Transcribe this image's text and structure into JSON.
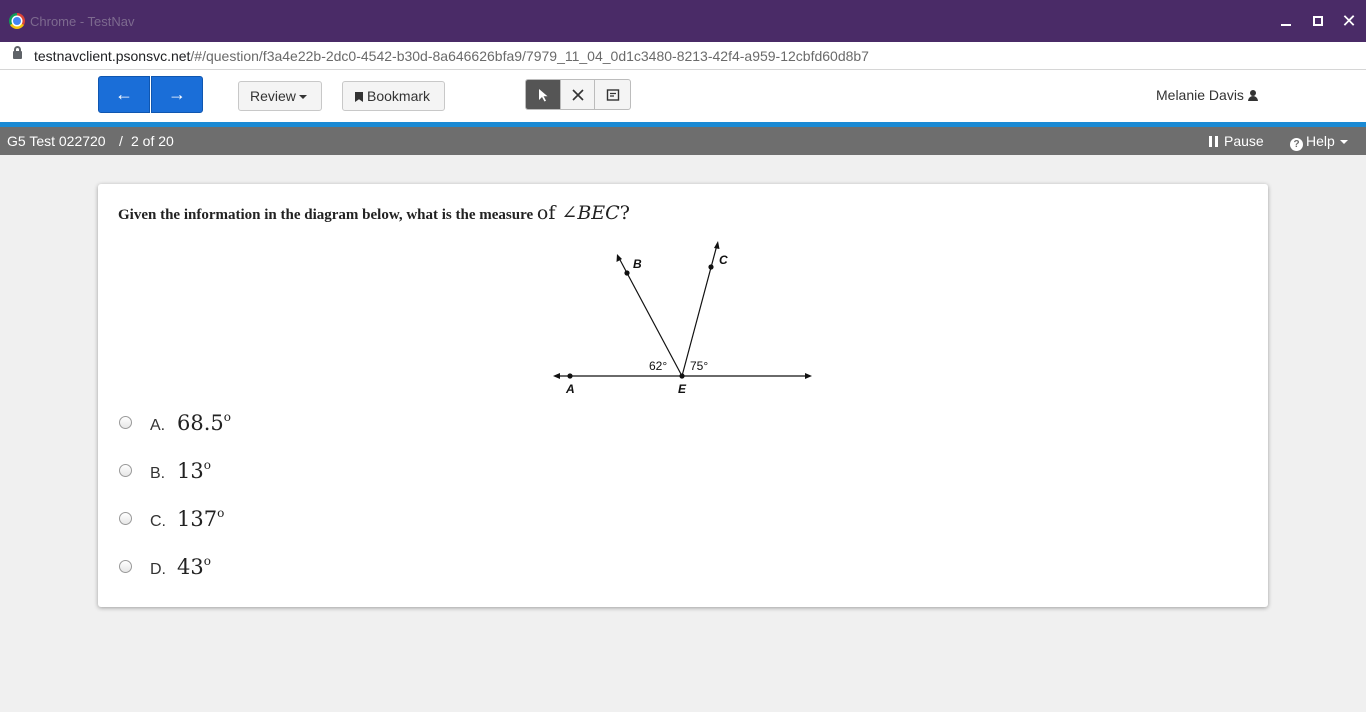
{
  "window": {
    "title": "Chrome - TestNav"
  },
  "browser": {
    "url_host": "testnavclient.psonsvc.net",
    "url_path": "/#/question/f3a4e22b-2dc0-4542-b30d-8a646626bfa9/7979_11_04_0d1c3480-8213-42f4-a959-12cbfd60d8b7"
  },
  "toolbar": {
    "back_label": "←",
    "next_label": "→",
    "review_label": "Review",
    "bookmark_label": "Bookmark",
    "tools": [
      "pointer-icon",
      "eliminator-icon",
      "notepad-icon"
    ],
    "active_tool": "pointer-icon",
    "user_name": "Melanie Davis"
  },
  "status": {
    "test_title": "G5 Test 022720",
    "separator": "/",
    "progress": "2 of 20",
    "pause_label": "Pause",
    "help_label": "Help"
  },
  "question": {
    "text": "Given the information in the diagram below, what is the measure",
    "math_of": "of ∠",
    "math_angle": "BEC",
    "math_end": "?",
    "diagram": {
      "label_a": "A",
      "label_b": "B",
      "label_c": "C",
      "label_e": "E",
      "angle_aeb": "62°",
      "angle_ced": "75°"
    },
    "options": [
      {
        "letter": "A.",
        "value": "68.5",
        "unit": "o"
      },
      {
        "letter": "B.",
        "value": "13",
        "unit": "o"
      },
      {
        "letter": "C.",
        "value": "137",
        "unit": "o"
      },
      {
        "letter": "D.",
        "value": "43",
        "unit": "o"
      }
    ]
  },
  "colors": {
    "titlebar": "#4a2b67",
    "nav_button": "#1a6ed8",
    "accent_bar": "#1a8ad4",
    "statusbar": "#6e6e6e"
  }
}
